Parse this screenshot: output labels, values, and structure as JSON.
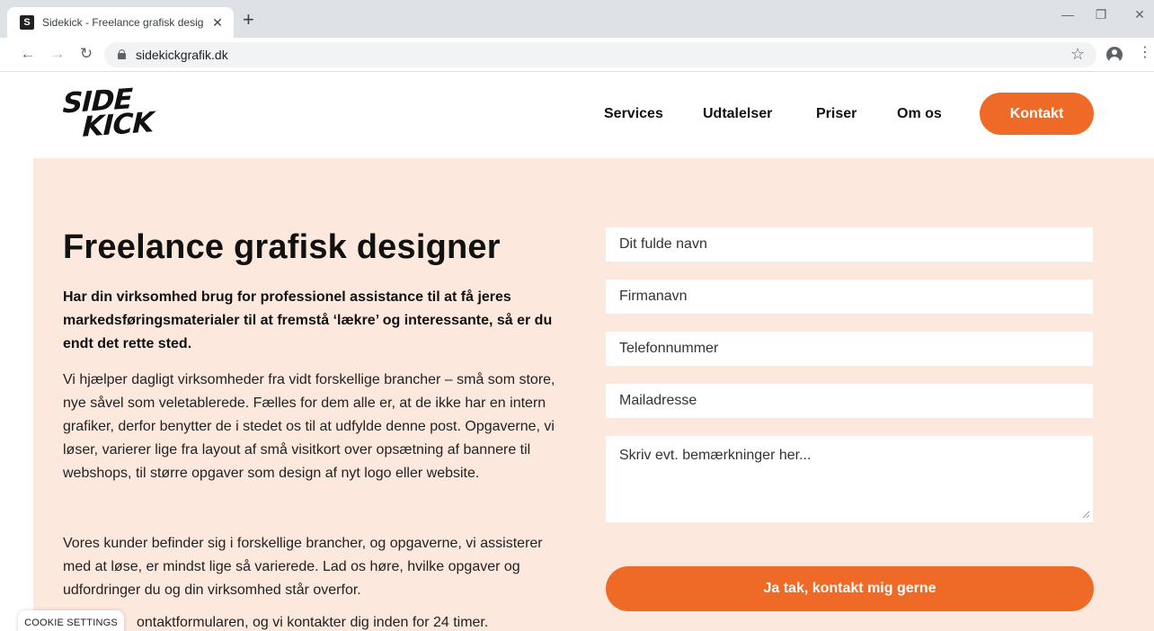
{
  "browser": {
    "tab_title": "Sidekick - Freelance grafisk desig",
    "favicon_letter": "S",
    "close_glyph": "✕",
    "new_tab_glyph": "+",
    "url": "sidekickgrafik.dk",
    "window_controls": {
      "minimize": "—",
      "restore": "❐",
      "close": "✕"
    },
    "nav": {
      "back": "←",
      "forward": "→",
      "reload": "↻"
    },
    "star_glyph": "☆",
    "menu_glyph": "⋮"
  },
  "site": {
    "logo": {
      "line1": "SIDE",
      "line2": "KICK"
    },
    "nav": [
      "Services",
      "Udtalelser",
      "Priser",
      "Om os"
    ],
    "cta": "Kontakt",
    "accent_color": "#ef6a26",
    "hero_bg": "#fde8de"
  },
  "hero": {
    "title": "Freelance grafisk designer",
    "lead": "Har din virksomhed brug for professionel assistance til at få jeres markedsføringsmaterialer til at fremstå ‘lækre’ og interessante, så er du endt det rette sted.",
    "para1": "Vi hjælper dagligt virksomheder fra vidt forskellige brancher – små som store, nye såvel som veletablerede. Fælles for dem alle er, at de ikke har en intern grafiker, derfor benytter de i stedet os til at udfylde denne post. Opgaverne, vi løser, varierer lige fra layout af små visitkort over opsætning af bannere til webshops, til større opgaver som design af nyt logo eller website.",
    "para2": "Vores kunder befinder sig i forskellige brancher, og opgaverne, vi assisterer med at løse, er mindst lige så varierede. Lad os høre, hvilke opgaver og udfordringer du og din virksomhed står overfor.",
    "para3": "ontaktformularen, og vi kontakter dig inden for 24 timer."
  },
  "form": {
    "name_placeholder": "Dit fulde navn",
    "company_placeholder": "Firmanavn",
    "phone_placeholder": "Telefonnummer",
    "email_placeholder": "Mailadresse",
    "notes_placeholder": "Skriv evt. bemærkninger her...",
    "submit": "Ja tak, kontakt mig gerne"
  },
  "cookie": {
    "label": "COOKIE SETTINGS"
  }
}
